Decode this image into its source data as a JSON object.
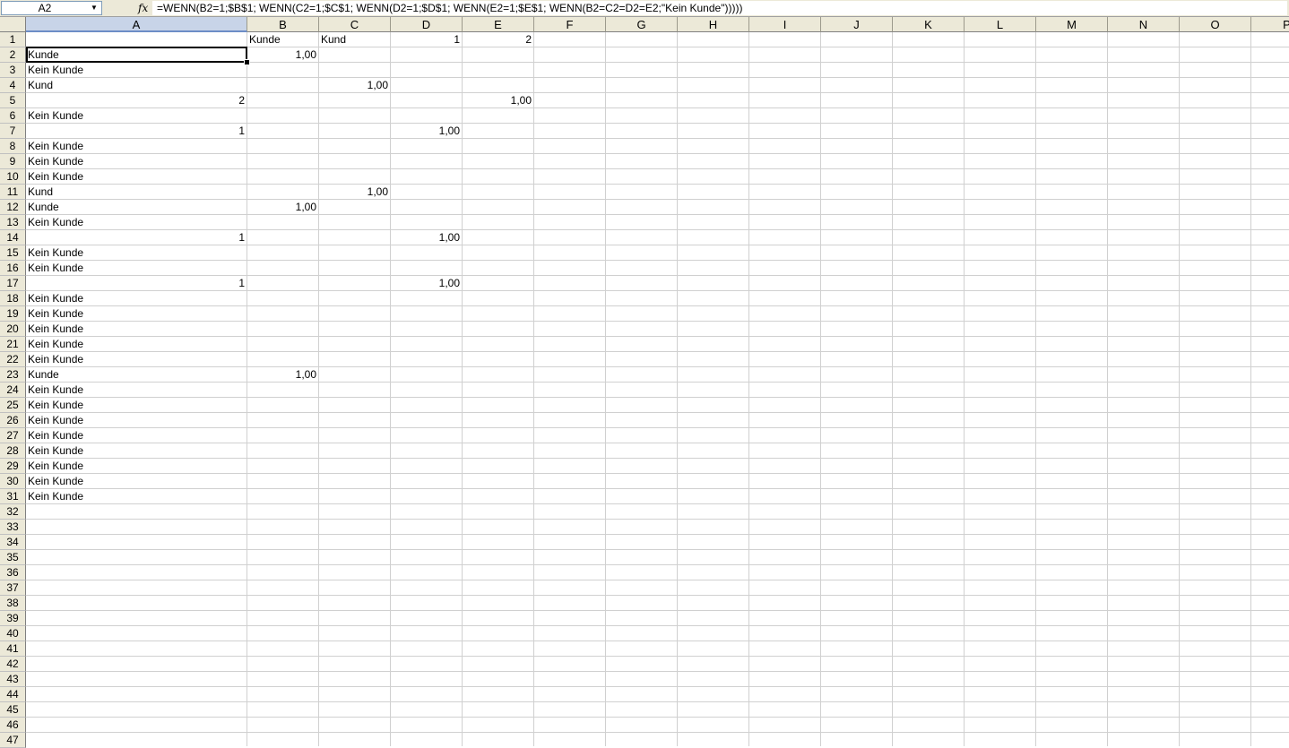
{
  "formula_bar": {
    "name_box": "A2",
    "fx_icon": "fx-icon",
    "formula": "=WENN(B2=1;$B$1; WENN(C2=1;$C$1; WENN(D2=1;$D$1; WENN(E2=1;$E$1; WENN(B2=C2=D2=E2;\"Kein Kunde\")))))"
  },
  "columns": [
    "A",
    "B",
    "C",
    "D",
    "E",
    "F",
    "G",
    "H",
    "I",
    "J",
    "K",
    "L",
    "M",
    "N",
    "O",
    "P"
  ],
  "active_column": "A",
  "selected_cell": "A2",
  "rows": [
    "1",
    "2",
    "3",
    "4",
    "5",
    "6",
    "7",
    "8",
    "9",
    "10",
    "11",
    "12",
    "13",
    "14",
    "15",
    "16",
    "17",
    "18",
    "19",
    "20",
    "21",
    "22",
    "23",
    "24",
    "25",
    "26",
    "27",
    "28",
    "29",
    "30",
    "31",
    "32",
    "33",
    "34",
    "35",
    "36",
    "37",
    "38",
    "39",
    "40",
    "41",
    "42",
    "43",
    "44",
    "45",
    "46",
    "47"
  ],
  "cells": [
    {
      "ref": "B1",
      "value": "Kunde",
      "align": "left"
    },
    {
      "ref": "C1",
      "value": "Kund",
      "align": "left"
    },
    {
      "ref": "D1",
      "value": "1",
      "align": "right"
    },
    {
      "ref": "E1",
      "value": "2",
      "align": "right"
    },
    {
      "ref": "A2",
      "value": "Kunde",
      "align": "left"
    },
    {
      "ref": "B2",
      "value": "1,00",
      "align": "right"
    },
    {
      "ref": "A3",
      "value": "Kein Kunde",
      "align": "left"
    },
    {
      "ref": "A4",
      "value": "Kund",
      "align": "left"
    },
    {
      "ref": "C4",
      "value": "1,00",
      "align": "right"
    },
    {
      "ref": "A5",
      "value": "2",
      "align": "right"
    },
    {
      "ref": "E5",
      "value": "1,00",
      "align": "right"
    },
    {
      "ref": "A6",
      "value": "Kein Kunde",
      "align": "left"
    },
    {
      "ref": "A7",
      "value": "1",
      "align": "right"
    },
    {
      "ref": "D7",
      "value": "1,00",
      "align": "right"
    },
    {
      "ref": "A8",
      "value": "Kein Kunde",
      "align": "left"
    },
    {
      "ref": "A9",
      "value": "Kein Kunde",
      "align": "left"
    },
    {
      "ref": "A10",
      "value": "Kein Kunde",
      "align": "left"
    },
    {
      "ref": "A11",
      "value": "Kund",
      "align": "left"
    },
    {
      "ref": "C11",
      "value": "1,00",
      "align": "right"
    },
    {
      "ref": "A12",
      "value": "Kunde",
      "align": "left"
    },
    {
      "ref": "B12",
      "value": "1,00",
      "align": "right"
    },
    {
      "ref": "A13",
      "value": "Kein Kunde",
      "align": "left"
    },
    {
      "ref": "A14",
      "value": "1",
      "align": "right"
    },
    {
      "ref": "D14",
      "value": "1,00",
      "align": "right"
    },
    {
      "ref": "A15",
      "value": "Kein Kunde",
      "align": "left"
    },
    {
      "ref": "A16",
      "value": "Kein Kunde",
      "align": "left"
    },
    {
      "ref": "A17",
      "value": "1",
      "align": "right"
    },
    {
      "ref": "D17",
      "value": "1,00",
      "align": "right"
    },
    {
      "ref": "A18",
      "value": "Kein Kunde",
      "align": "left"
    },
    {
      "ref": "A19",
      "value": "Kein Kunde",
      "align": "left"
    },
    {
      "ref": "A20",
      "value": "Kein Kunde",
      "align": "left"
    },
    {
      "ref": "A21",
      "value": "Kein Kunde",
      "align": "left"
    },
    {
      "ref": "A22",
      "value": "Kein Kunde",
      "align": "left"
    },
    {
      "ref": "A23",
      "value": "Kunde",
      "align": "left"
    },
    {
      "ref": "B23",
      "value": "1,00",
      "align": "right"
    },
    {
      "ref": "A24",
      "value": "Kein Kunde",
      "align": "left"
    },
    {
      "ref": "A25",
      "value": "Kein Kunde",
      "align": "left"
    },
    {
      "ref": "A26",
      "value": "Kein Kunde",
      "align": "left"
    },
    {
      "ref": "A27",
      "value": "Kein Kunde",
      "align": "left"
    },
    {
      "ref": "A28",
      "value": "Kein Kunde",
      "align": "left"
    },
    {
      "ref": "A29",
      "value": "Kein Kunde",
      "align": "left"
    },
    {
      "ref": "A30",
      "value": "Kein Kunde",
      "align": "left"
    },
    {
      "ref": "A31",
      "value": "Kein Kunde",
      "align": "left"
    }
  ]
}
